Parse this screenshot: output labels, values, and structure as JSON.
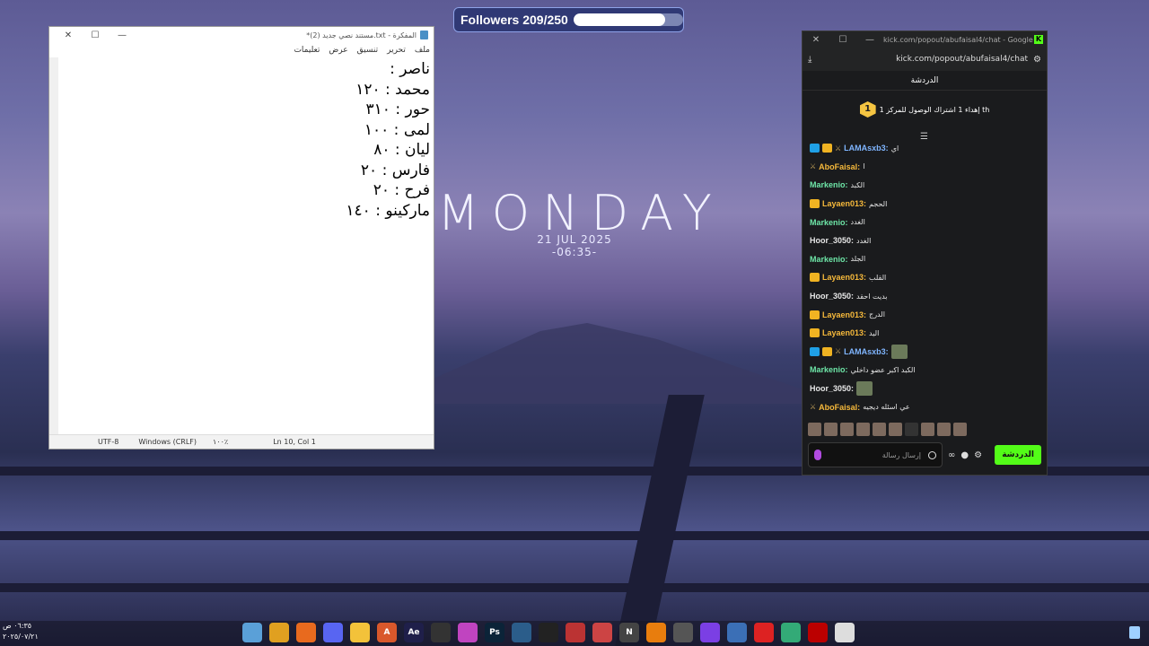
{
  "followers": {
    "label": "Followers 209/250",
    "progress": 0.836
  },
  "wallpaper": {
    "day": "MONDAY",
    "date": "21 JUL 2025",
    "time": "-06:35-"
  },
  "notepad": {
    "title": "*مستند نصي جديد (2).txt - المفكرة",
    "menu": [
      "ملف",
      "تحرير",
      "تنسيق",
      "عرض",
      "تعليمات"
    ],
    "lines": [
      "ناصر :",
      "محمد : ١٢٠",
      "حور : ٣١٠",
      "لمى : ١٠٠",
      "ليان : ٨٠",
      "فارس : ٢٠",
      "فرح : ٢٠",
      "ماركينو : ١٤٠"
    ],
    "status": {
      "position": "Ln 10, Col 1",
      "zoom": "١٠٠٪",
      "line_ending": "Windows (CRLF)",
      "encoding": "UTF-8"
    }
  },
  "chat": {
    "window_title": "kick.com/popout/abufaisal4/chat - Google C...",
    "url": "kick.com/popout/abufaisal4/chat",
    "header": "الدردشة",
    "pinned": "إهداء 1 اشتراك الوصول للمركز 1 th",
    "pinned_badge": "1",
    "messages": [
      {
        "user": "LAMAsxb3:",
        "text": "اي",
        "color": "#7fb5ff",
        "badges": [
          "blue",
          "crown",
          "sword"
        ]
      },
      {
        "user": "AboFaisal:",
        "text": "ا",
        "color": "#f6b93b",
        "badges": [
          "sword"
        ]
      },
      {
        "user": "Markenio:",
        "text": "الكبد",
        "color": "#6ee7a8",
        "badges": []
      },
      {
        "user": "Layaen013:",
        "text": "الحجم",
        "color": "#f6b93b",
        "badges": [
          "crown"
        ]
      },
      {
        "user": "Markenio:",
        "text": "الغدد",
        "color": "#6ee7a8",
        "badges": []
      },
      {
        "user": "Hoor_3050:",
        "text": "الغدد",
        "color": "#e6e6e6",
        "badges": []
      },
      {
        "user": "Markenio:",
        "text": "الجلد",
        "color": "#6ee7a8",
        "badges": []
      },
      {
        "user": "Layaen013:",
        "text": "القلب",
        "color": "#f6b93b",
        "badges": [
          "crown"
        ]
      },
      {
        "user": "Hoor_3050:",
        "text": "بديت احقد",
        "color": "#e6e6e6",
        "badges": []
      },
      {
        "user": "Layaen013:",
        "text": "الدرج",
        "color": "#f6b93b",
        "badges": [
          "crown"
        ]
      },
      {
        "user": "Layaen013:",
        "text": "اليد",
        "color": "#f6b93b",
        "badges": [
          "crown"
        ]
      },
      {
        "user": "LAMAsxb3:",
        "text": "",
        "color": "#7fb5ff",
        "badges": [
          "blue",
          "crown",
          "sword"
        ],
        "emote": true
      },
      {
        "user": "Markenio:",
        "text": "الكبد اكبر عضو داخلي",
        "color": "#6ee7a8",
        "badges": []
      },
      {
        "user": "Hoor_3050:",
        "text": "",
        "color": "#e6e6e6",
        "badges": [],
        "emote": true
      },
      {
        "user": "AboFaisal:",
        "text": "عي اسئله ديجيه",
        "color": "#f6b93b",
        "badges": [
          "sword"
        ]
      }
    ],
    "input_placeholder": "إرسال رسالة",
    "send_label": "الدردشة"
  },
  "taskbar": {
    "clock_time": "٠٦:٣٥ ص",
    "clock_date": "٢٠٢٥/٠٧/٢١",
    "icons": [
      {
        "name": "notepad-icon",
        "color": "#5aa0d8",
        "glyph": ""
      },
      {
        "name": "chrome-icon",
        "color": "#e0a020",
        "glyph": ""
      },
      {
        "name": "app-orange-icon",
        "color": "#e86a1e",
        "glyph": ""
      },
      {
        "name": "discord-icon",
        "color": "#5865f2",
        "glyph": ""
      },
      {
        "name": "file-explorer-icon",
        "color": "#f3c23a",
        "glyph": ""
      },
      {
        "name": "app-a-icon",
        "color": "#d9582b",
        "glyph": "A"
      },
      {
        "name": "after-effects-icon",
        "color": "#1f1f4a",
        "glyph": "Ae"
      },
      {
        "name": "app-dark-icon",
        "color": "#333",
        "glyph": ""
      },
      {
        "name": "app-color-icon",
        "color": "#c044c0",
        "glyph": ""
      },
      {
        "name": "photoshop-icon",
        "color": "#0b2338",
        "glyph": "Ps"
      },
      {
        "name": "app-blue-icon",
        "color": "#2b5d8a",
        "glyph": ""
      },
      {
        "name": "app-black-icon",
        "color": "#222",
        "glyph": ""
      },
      {
        "name": "app-red-icon",
        "color": "#b33",
        "glyph": ""
      },
      {
        "name": "app-red2-icon",
        "color": "#c44",
        "glyph": ""
      },
      {
        "name": "app-n-icon",
        "color": "#444",
        "glyph": "N"
      },
      {
        "name": "blender-icon",
        "color": "#e87d0d",
        "glyph": ""
      },
      {
        "name": "app-gray-icon",
        "color": "#555",
        "glyph": ""
      },
      {
        "name": "app-purple-icon",
        "color": "#7b3fe4",
        "glyph": ""
      },
      {
        "name": "app-pc-icon",
        "color": "#3b6fb6",
        "glyph": ""
      },
      {
        "name": "app-rec-icon",
        "color": "#d22",
        "glyph": ""
      },
      {
        "name": "app-green-icon",
        "color": "#3a7",
        "glyph": ""
      },
      {
        "name": "app-vote-icon",
        "color": "#b00",
        "glyph": ""
      },
      {
        "name": "app-grid-icon",
        "color": "#ddd",
        "glyph": ""
      }
    ]
  }
}
